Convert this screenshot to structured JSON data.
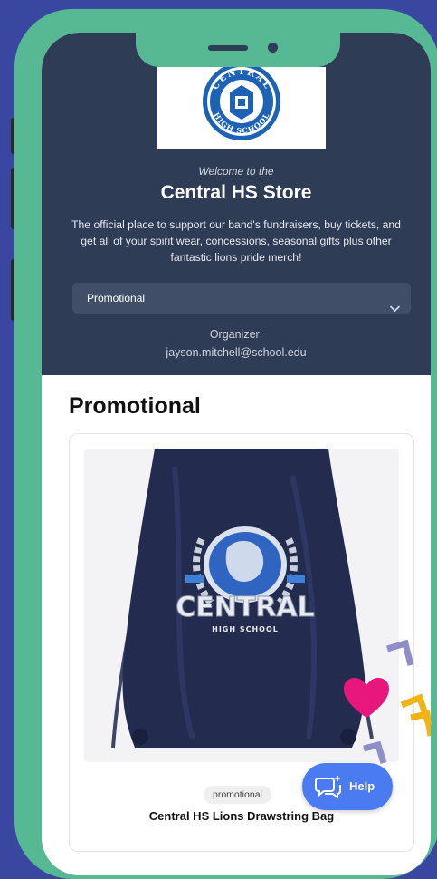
{
  "store": {
    "logo_text_top": "CENTRAL",
    "logo_text_bottom": "HIGH SCHOOL",
    "welcome": "Welcome to the",
    "name": "Central HS Store",
    "description": "The official place to support our band's fundraisers, buy tickets, and get all of your spirit wear, concessions, seasonal gifts plus other fantastic lions pride merch!"
  },
  "category_select": {
    "selected": "Promotional"
  },
  "organizer": {
    "label": "Organizer:",
    "email": "jayson.mitchell@school.edu"
  },
  "section": {
    "title": "Promotional"
  },
  "product": {
    "bag_text": "CENTRAL",
    "bag_subtext": "HIGH SCHOOL",
    "tag": "promotional",
    "title": "Central HS Lions Drawstring Bag"
  },
  "help": {
    "label": "Help"
  },
  "icons": {
    "dropdown": "chevron-down-icon",
    "help": "chat-bubble-icon",
    "heart": "heart-icon"
  },
  "colors": {
    "background": "#3a47a0",
    "phone_frame": "#57b894",
    "header": "#2f3c55",
    "help_button": "#4b7bf0",
    "heart": "#e8177e"
  }
}
